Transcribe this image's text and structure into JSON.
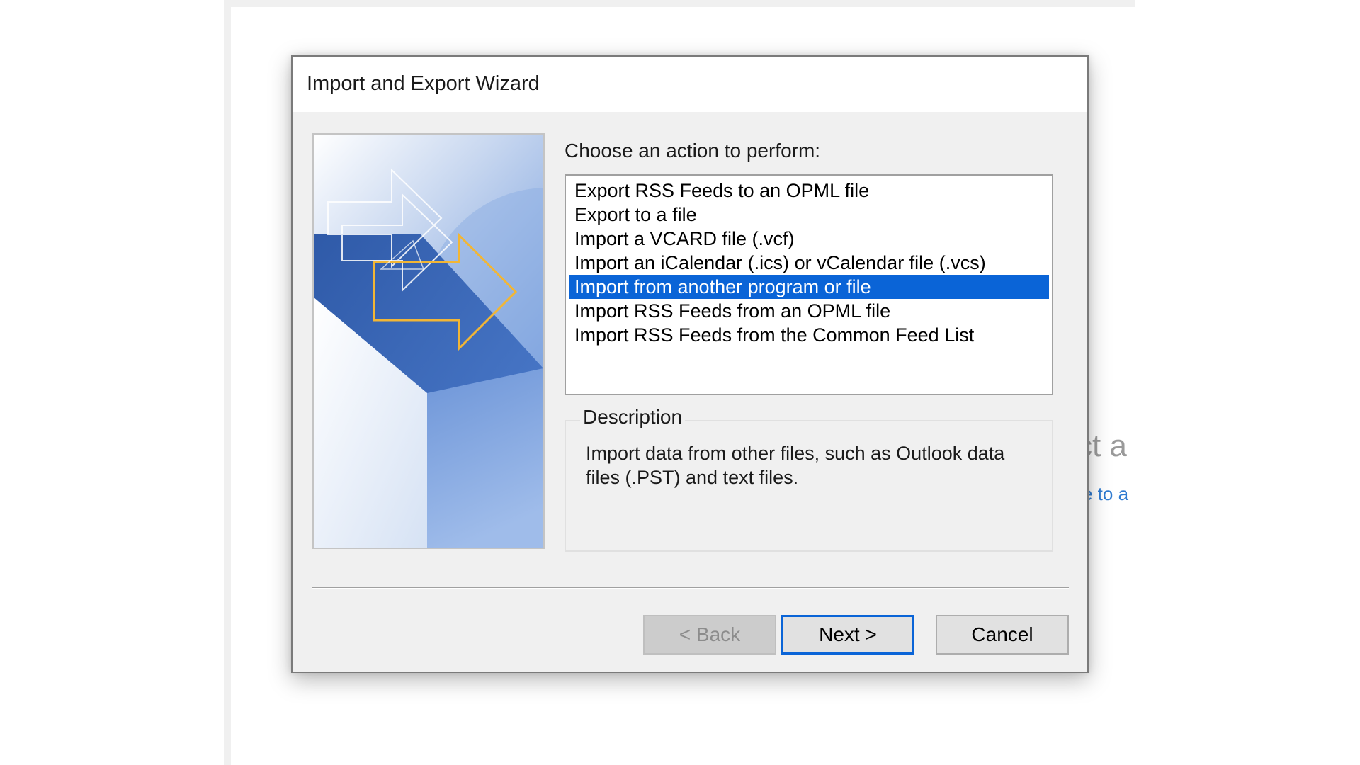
{
  "background_app": {
    "heading_fragment": "ct a",
    "link_fragment": "e to a"
  },
  "dialog": {
    "title": "Import and Export Wizard",
    "prompt": "Choose an action to perform:",
    "actions": [
      {
        "label": "Export RSS Feeds to an OPML file",
        "selected": false
      },
      {
        "label": "Export to a file",
        "selected": false
      },
      {
        "label": "Import a VCARD file (.vcf)",
        "selected": false
      },
      {
        "label": "Import an iCalendar (.ics) or vCalendar file (.vcs)",
        "selected": false
      },
      {
        "label": "Import from another program or file",
        "selected": true
      },
      {
        "label": "Import RSS Feeds from an OPML file",
        "selected": false
      },
      {
        "label": "Import RSS Feeds from the Common Feed List",
        "selected": false
      }
    ],
    "description": {
      "legend": "Description",
      "text": "Import data from other files, such as Outlook data files (.PST) and text files."
    },
    "buttons": {
      "back": "< Back",
      "next": "Next >",
      "cancel": "Cancel"
    }
  },
  "colors": {
    "selection": "#0a64d7",
    "dialog_bg": "#f0f0f0",
    "arrow_accent": "#f2b635",
    "image_blue": "#4a78c8"
  }
}
